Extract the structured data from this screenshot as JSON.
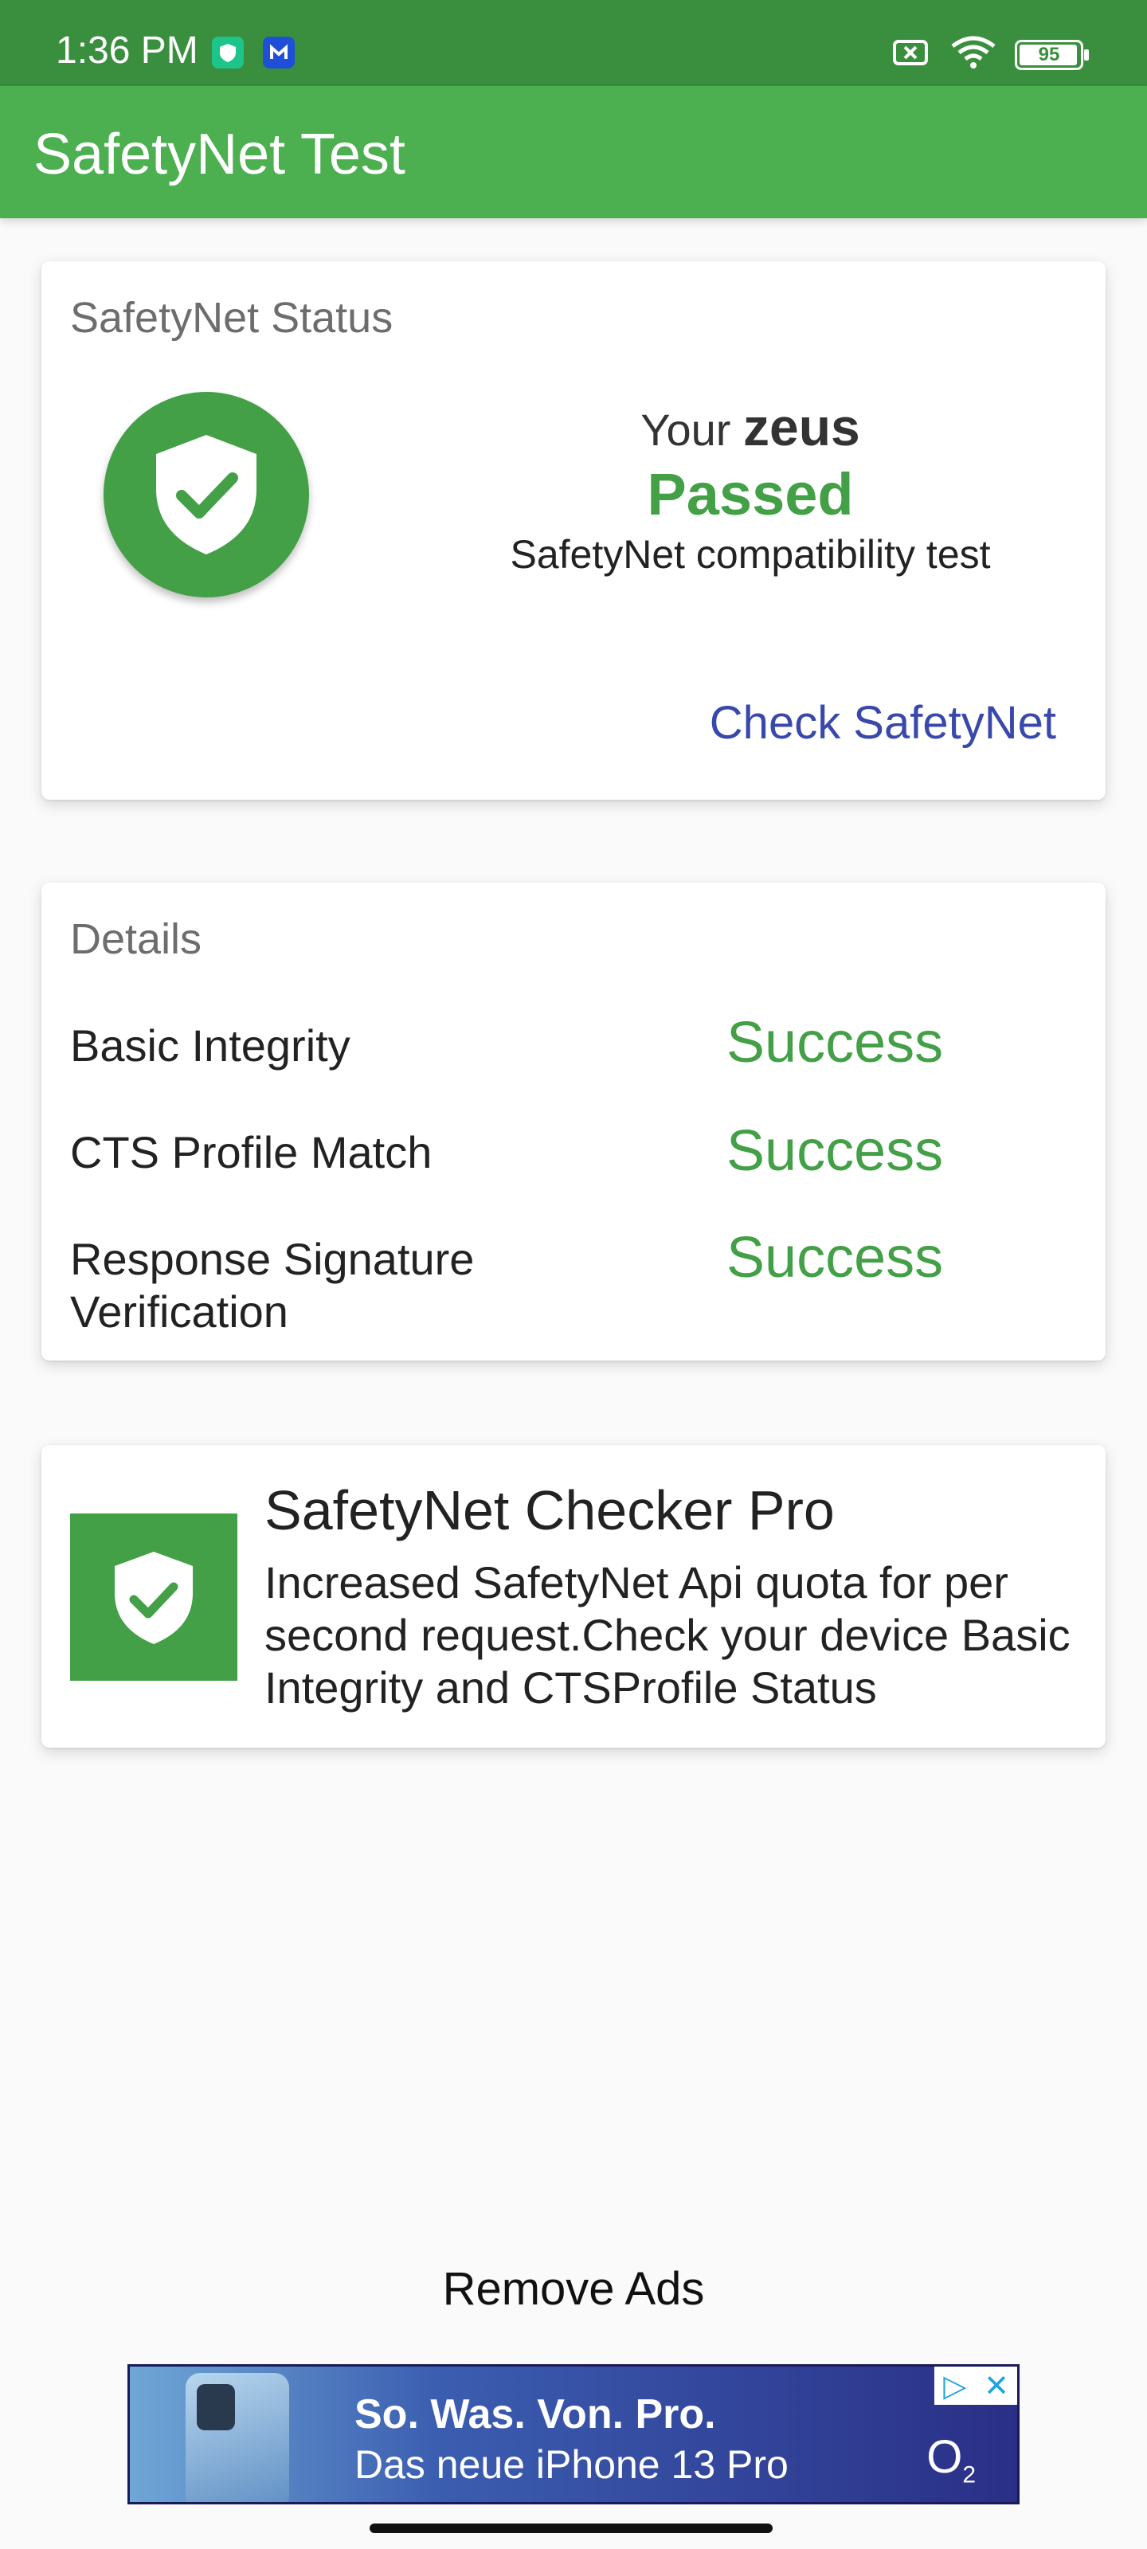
{
  "status_bar": {
    "time": "1:36 PM",
    "battery": "95",
    "icons": [
      "app-notification-icon",
      "malwarebytes-icon",
      "battery-saver-icon",
      "wifi-icon",
      "battery-icon"
    ]
  },
  "app_bar": {
    "title": "SafetyNet Test"
  },
  "status_card": {
    "title": "SafetyNet Status",
    "your_prefix": "Your",
    "device_name": "zeus",
    "result": "Passed",
    "subtitle": "SafetyNet compatibility test",
    "check_button": "Check SafetyNet"
  },
  "details_card": {
    "title": "Details",
    "rows": [
      {
        "label": "Basic Integrity",
        "value": "Success"
      },
      {
        "label": "CTS Profile Match",
        "value": "Success"
      },
      {
        "label": "Response Signature Verification",
        "value": "Success"
      }
    ]
  },
  "promo_card": {
    "title": "SafetyNet Checker Pro",
    "description": "Increased SafetyNet Api quota for per second request.Check your device Basic Integrity and CTSProfile Status"
  },
  "remove_ads": "Remove Ads",
  "ad": {
    "headline": "So. Was. Von. Pro.",
    "subline": "Das neue iPhone 13 Pro",
    "brand": "O",
    "brand_sub": "2"
  },
  "colors": {
    "status_bar": "#3a8f3e",
    "app_bar": "#4caf50",
    "success": "#43a047",
    "link": "#3949ab"
  }
}
